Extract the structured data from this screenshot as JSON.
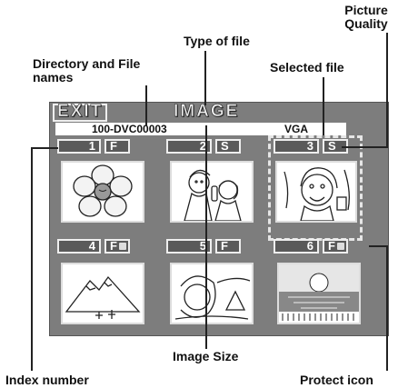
{
  "callouts": {
    "type_of_file": "Type of file",
    "picture_quality_1": "Picture",
    "picture_quality_2": "Quality",
    "dir_file_names_1": "Directory and File",
    "dir_file_names_2": "names",
    "selected_file": "Selected file",
    "image_size": "Image Size",
    "index_number": "Index number",
    "protect_icon": "Protect icon"
  },
  "screen": {
    "exit_label": "EXIT",
    "type_label": "IMAGE",
    "file_name": "100-DVC00003",
    "image_size": "VGA",
    "items": [
      {
        "index": "1",
        "quality": "F",
        "protected": false,
        "picture": "flower"
      },
      {
        "index": "2",
        "quality": "S",
        "protected": false,
        "picture": "couple"
      },
      {
        "index": "3",
        "quality": "S",
        "protected": false,
        "picture": "girl",
        "selected": true
      },
      {
        "index": "4",
        "quality": "F",
        "protected": true,
        "picture": "mountain"
      },
      {
        "index": "5",
        "quality": "F",
        "protected": false,
        "picture": "woman-seaside"
      },
      {
        "index": "6",
        "quality": "F",
        "protected": true,
        "picture": "sunset-sea"
      }
    ]
  },
  "colors": {
    "screen_bg": "#7d7d7d",
    "box_bg": "#5a5a5a",
    "text_light": "#eeeeee"
  }
}
